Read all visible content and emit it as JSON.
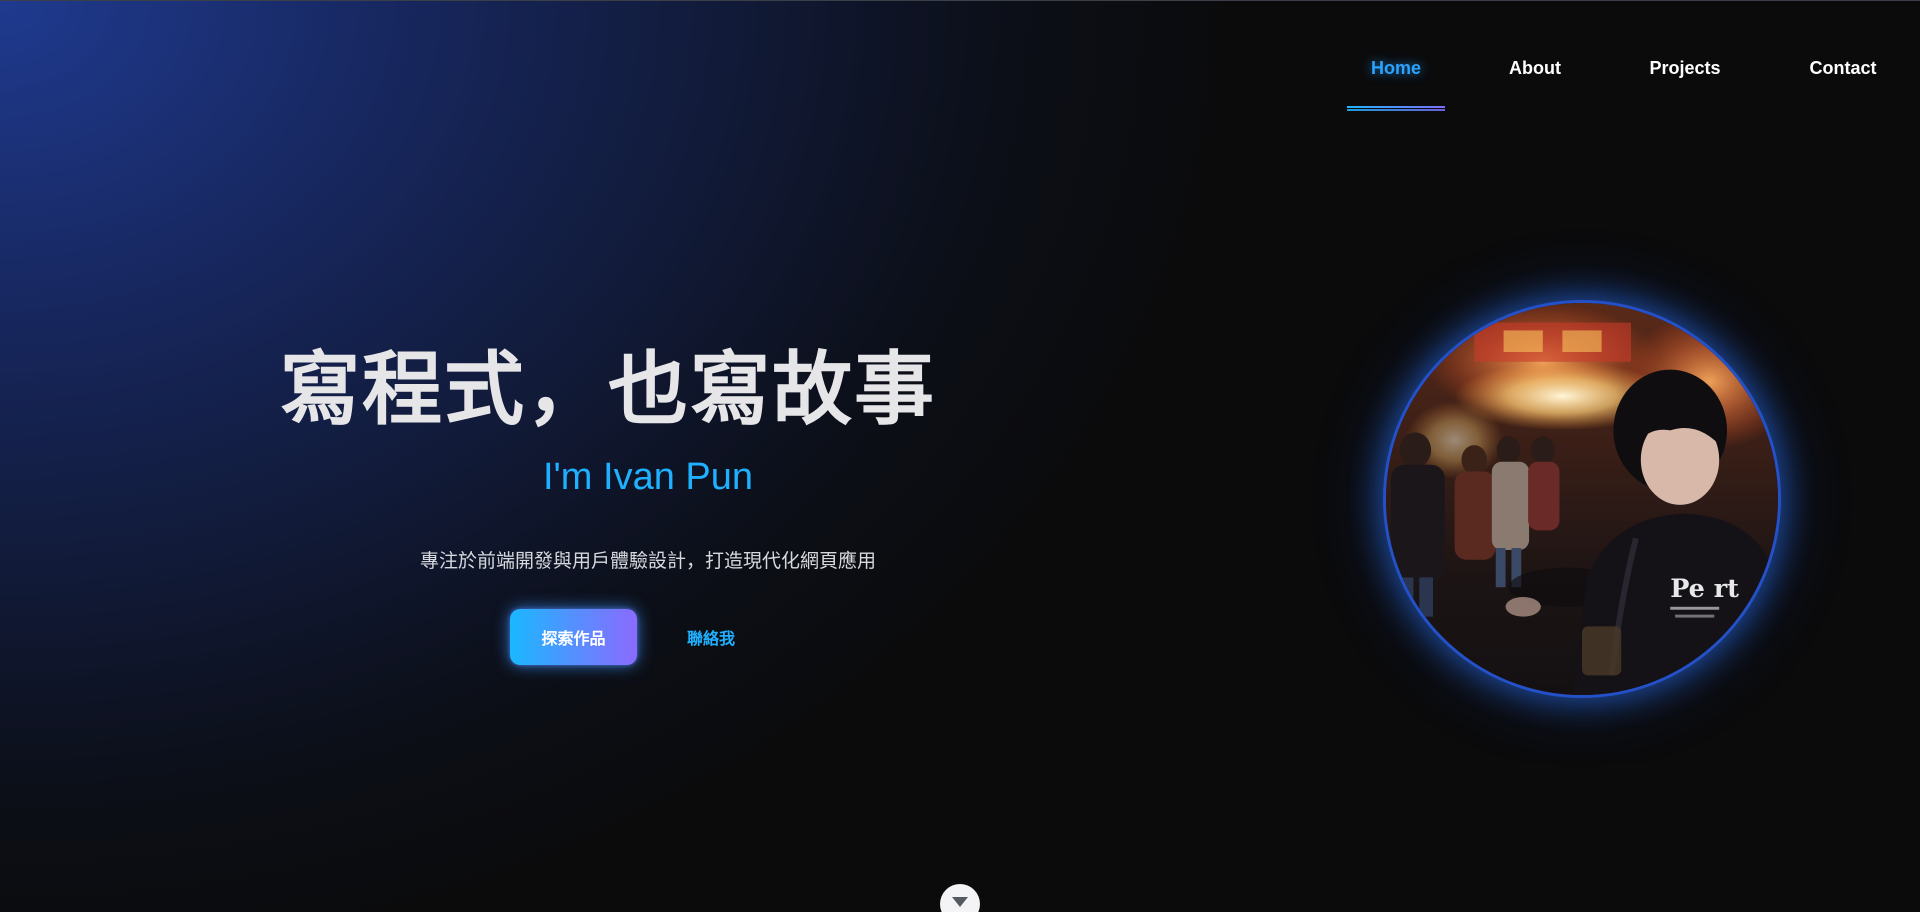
{
  "nav": {
    "items": [
      {
        "label": "Home",
        "active": true
      },
      {
        "label": "About",
        "active": false
      },
      {
        "label": "Projects",
        "active": false
      },
      {
        "label": "Contact",
        "active": false
      }
    ]
  },
  "hero": {
    "title": "寫程式，也寫故事",
    "subtitle": "I'm Ivan Pun",
    "description": "專注於前端開發與用戶體驗設計，打造現代化網頁應用",
    "primary_button": "探索作品",
    "secondary_button": "聯絡我"
  },
  "profile_photo": {
    "icon": "profile-photo"
  },
  "scroll_indicator": {
    "icon": "chevron-down-icon"
  },
  "colors": {
    "accent": "#1fb0ff",
    "accent_purple": "#8a6bff",
    "nav_active": "#2aa3ff",
    "background_dark": "#0b0b0c",
    "background_blue": "#1f3a8f"
  }
}
